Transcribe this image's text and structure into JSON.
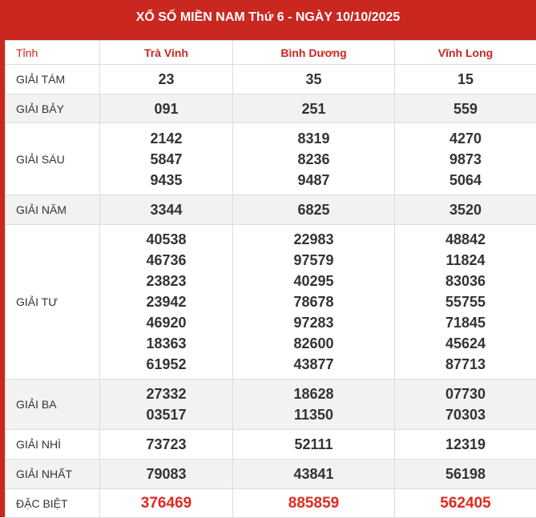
{
  "title": "XỔ SỐ MIỀN NAM Thứ 6 - NGÀY 10/10/2025",
  "columns": [
    "Tỉnh",
    "Trà Vinh",
    "Bình Dương",
    "Vĩnh Long"
  ],
  "rows": [
    {
      "label": "GIẢI TÁM",
      "values": [
        [
          "23"
        ],
        [
          "35"
        ],
        [
          "15"
        ]
      ]
    },
    {
      "label": "GIẢI BẢY",
      "values": [
        [
          "091"
        ],
        [
          "251"
        ],
        [
          "559"
        ]
      ]
    },
    {
      "label": "GIẢI SÁU",
      "values": [
        [
          "2142",
          "5847",
          "9435"
        ],
        [
          "8319",
          "8236",
          "9487"
        ],
        [
          "4270",
          "9873",
          "5064"
        ]
      ]
    },
    {
      "label": "GIẢI NĂM",
      "values": [
        [
          "3344"
        ],
        [
          "6825"
        ],
        [
          "3520"
        ]
      ]
    },
    {
      "label": "GIẢI TƯ",
      "values": [
        [
          "40538",
          "46736",
          "23823",
          "23942",
          "46920",
          "18363",
          "61952"
        ],
        [
          "22983",
          "97579",
          "40295",
          "78678",
          "97283",
          "82600",
          "43877"
        ],
        [
          "48842",
          "11824",
          "83036",
          "55755",
          "71845",
          "45624",
          "87713"
        ]
      ]
    },
    {
      "label": "GIẢI BA",
      "values": [
        [
          "27332",
          "03517"
        ],
        [
          "18628",
          "11350"
        ],
        [
          "07730",
          "70303"
        ]
      ]
    },
    {
      "label": "GIẢI NHÌ",
      "values": [
        [
          "73723"
        ],
        [
          "52111"
        ],
        [
          "12319"
        ]
      ]
    },
    {
      "label": "GIẢI NHẤT",
      "values": [
        [
          "79083"
        ],
        [
          "43841"
        ],
        [
          "56198"
        ]
      ]
    },
    {
      "label": "ĐẶC BIỆT",
      "values": [
        [
          "376469"
        ],
        [
          "885859"
        ],
        [
          "562405"
        ]
      ]
    }
  ]
}
